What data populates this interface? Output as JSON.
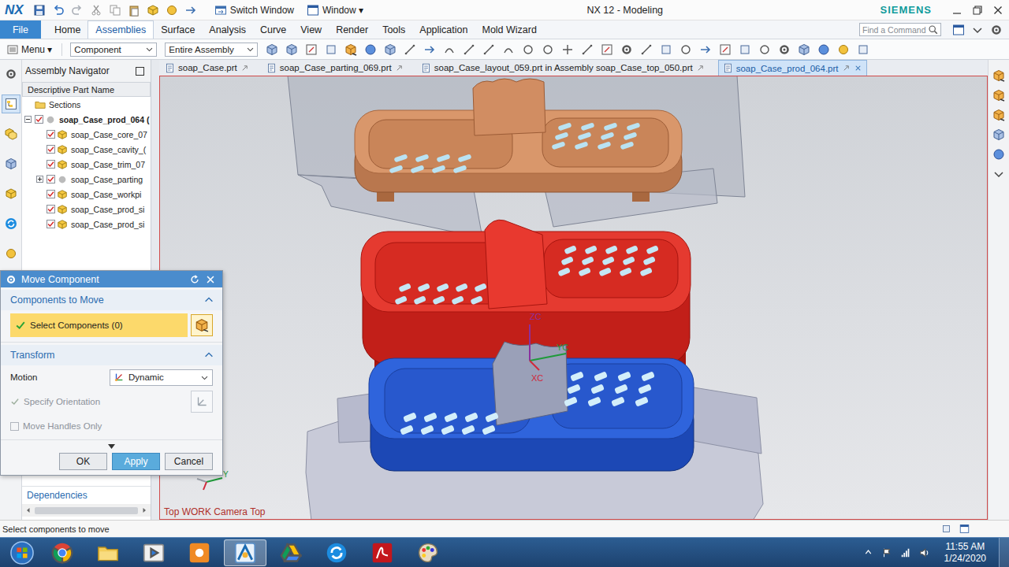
{
  "window": {
    "app_logo": "NX",
    "title": "NX 12 - Modeling",
    "brand": "SIEMENS",
    "quick_access": [
      {
        "label": "Switch Window"
      },
      {
        "label": "Window ▾"
      }
    ]
  },
  "ribbon": {
    "tabs": [
      {
        "label": "File",
        "kind": "file",
        "selected": false
      },
      {
        "label": "Home",
        "kind": "tab",
        "selected": false
      },
      {
        "label": "Assemblies",
        "kind": "tab",
        "selected": true
      },
      {
        "label": "Surface",
        "kind": "tab",
        "selected": false
      },
      {
        "label": "Analysis",
        "kind": "tab",
        "selected": false
      },
      {
        "label": "Curve",
        "kind": "tab",
        "selected": false
      },
      {
        "label": "View",
        "kind": "tab",
        "selected": false
      },
      {
        "label": "Render",
        "kind": "tab",
        "selected": false
      },
      {
        "label": "Tools",
        "kind": "tab",
        "selected": false
      },
      {
        "label": "Application",
        "kind": "tab",
        "selected": false
      },
      {
        "label": "Mold Wizard",
        "kind": "tab",
        "selected": false
      }
    ],
    "search": {
      "placeholder": "Find a Command"
    }
  },
  "toolbar": {
    "menu": "Menu ▾",
    "filters": [
      {
        "label": "Component"
      },
      {
        "label": "Entire Assembly"
      }
    ]
  },
  "resource_bar": [
    {
      "selected": false
    },
    {
      "selected": true
    },
    {
      "selected": false
    },
    {
      "selected": false
    },
    {
      "selected": false
    },
    {
      "selected": false
    },
    {
      "selected": false
    }
  ],
  "navigator": {
    "title": "Assembly Navigator",
    "column": "Descriptive Part Name",
    "items": [
      {
        "label": "Sections",
        "kind": "folder",
        "level": 0
      },
      {
        "label": "soap_Case_prod_064 (",
        "kind": "assembly",
        "level": 0,
        "expanded": true,
        "checked": true,
        "work": true
      },
      {
        "label": "soap_Case_core_07",
        "kind": "part",
        "level": 1,
        "checked": true,
        "work": false
      },
      {
        "label": "soap_Case_cavity_(",
        "kind": "part",
        "level": 1,
        "checked": true,
        "work": false
      },
      {
        "label": "soap_Case_trim_07",
        "kind": "part",
        "level": 1,
        "checked": true,
        "work": false
      },
      {
        "label": "soap_Case_parting",
        "kind": "assembly",
        "level": 1,
        "expanded": false,
        "checked": true,
        "work": false
      },
      {
        "label": "soap_Case_workpi",
        "kind": "part",
        "level": 1,
        "checked": true,
        "work": false
      },
      {
        "label": "soap_Case_prod_si",
        "kind": "part",
        "level": 1,
        "checked": true,
        "work": false
      },
      {
        "label": "soap_Case_prod_si",
        "kind": "part",
        "level": 1,
        "checked": true,
        "work": false
      }
    ],
    "footer": "Dependencies"
  },
  "dialog": {
    "title": "Move Component",
    "groups": [
      {
        "title": "Components to Move",
        "expanded": true
      },
      {
        "title": "Transform",
        "expanded": true
      }
    ],
    "selection": {
      "label": "Select Components (0)",
      "done": true
    },
    "motion": {
      "label": "Motion",
      "value": "Dynamic"
    },
    "orientation": {
      "label": "Specify Orientation",
      "disabled": true,
      "done": true
    },
    "handles_only": {
      "label": "Move Handles Only",
      "checked": false,
      "disabled": true
    },
    "buttons": [
      {
        "label": "OK",
        "selected": false
      },
      {
        "label": "Apply",
        "selected": true
      },
      {
        "label": "Cancel",
        "selected": false
      }
    ]
  },
  "document_tabs": [
    {
      "label": "soap_Case.prt",
      "selected": false
    },
    {
      "label": "soap_Case_parting_069.prt",
      "selected": false
    },
    {
      "label": "soap_Case_layout_059.prt in Assembly soap_Case_top_050.prt",
      "selected": false
    },
    {
      "label": "soap_Case_prod_064.prt",
      "selected": true
    }
  ],
  "graphics": {
    "view_label": "Top WORK Camera Top",
    "wcs_axes": [
      {
        "label": "ZC",
        "color": "#8a2f9e"
      },
      {
        "label": "YC",
        "color": "#1f9a3a"
      },
      {
        "label": "XC",
        "color": "#d0283a"
      }
    ],
    "view_triad": [
      {
        "label": "Y",
        "color": "#1f9a3a"
      }
    ]
  },
  "status_bar": {
    "prompt": "Select components to move"
  },
  "taskbar": {
    "apps": [
      {
        "selected": false
      },
      {
        "selected": false
      },
      {
        "selected": false
      },
      {
        "selected": false
      },
      {
        "selected": true
      },
      {
        "selected": false
      },
      {
        "selected": false
      },
      {
        "selected": false
      },
      {
        "selected": false
      }
    ],
    "time": "11:55 AM",
    "date": "1/24/2020"
  }
}
